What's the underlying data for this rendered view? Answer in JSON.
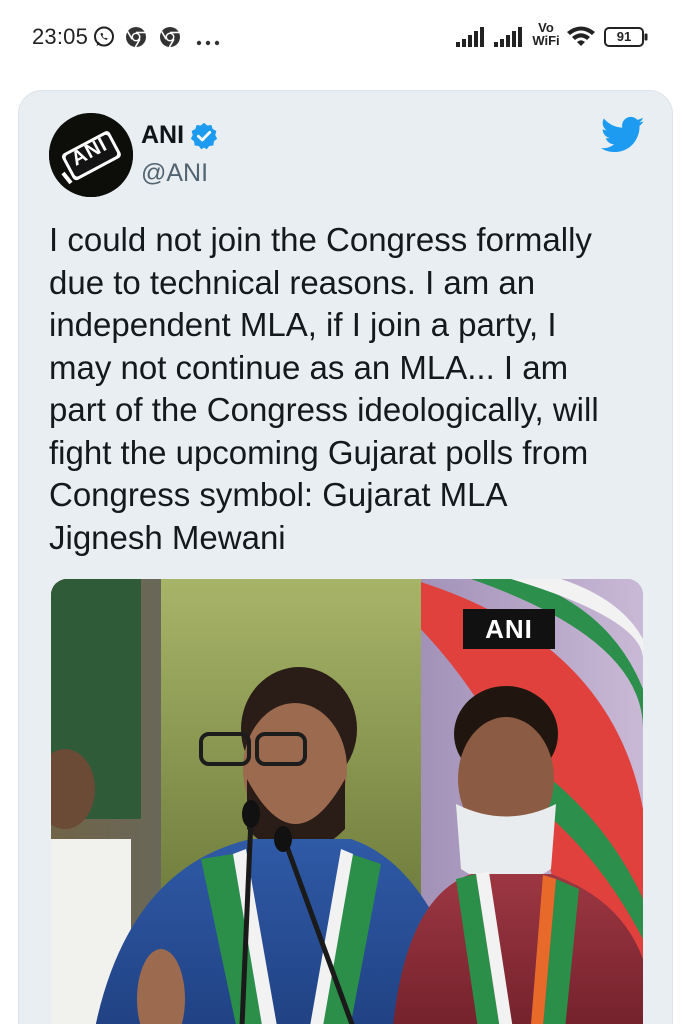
{
  "status_bar": {
    "time": "23:05",
    "left_icons": [
      "whatsapp-icon",
      "chrome-icon",
      "chrome-icon",
      "more-dots-icon"
    ],
    "vowifi_top": "Vo",
    "vowifi_bottom": "WiFi",
    "battery_level": "91"
  },
  "tweet": {
    "author_name": "ANI",
    "handle": "@ANI",
    "verified": true,
    "avatar_text": "ANI",
    "text": "I could not join the Congress formally\ndue to technical reasons. I am an\nindependent MLA, if I join a party, I\nmay not continue as an MLA... I am\npart of the Congress ideologically, will\nfight the upcoming Gujarat polls from\nCongress symbol: Gujarat MLA\nJignesh Mewani",
    "media": {
      "watermark": "ANI"
    }
  },
  "colors": {
    "twitter_blue": "#1d9bf0",
    "card_bg": "#e9eef2"
  }
}
